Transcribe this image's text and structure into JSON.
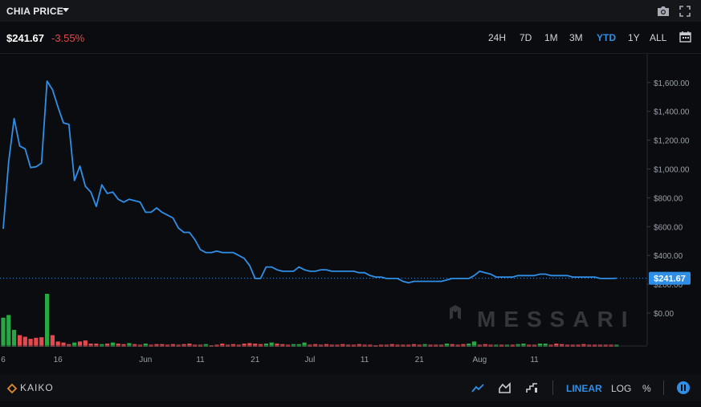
{
  "header": {
    "title": "CHIA PRICE",
    "price": "$241.67",
    "change": "-3.55%"
  },
  "ranges": [
    "24H",
    "7D",
    "1M",
    "3M",
    "YTD",
    "1Y",
    "ALL"
  ],
  "active_range": "YTD",
  "icons": {
    "camera": "camera-icon",
    "expand": "fullscreen-icon",
    "calendar": "calendar-icon"
  },
  "footer": {
    "brand": "KAIKO",
    "scales": [
      "LINEAR",
      "LOG",
      "%"
    ],
    "active_scale": "LINEAR",
    "tools": [
      "line-chart-icon",
      "area-chart-icon",
      "step-chart-icon"
    ]
  },
  "watermark": "MESSARI",
  "colors": {
    "line": "#2f8fe6",
    "up": "#27a844",
    "down": "#e5484d",
    "background": "#0b0c0f"
  },
  "chart_data": {
    "type": "line",
    "yticks": [
      "$1,600.00",
      "$1,400.00",
      "$1,200.00",
      "$1,000.00",
      "$800.00",
      "$600.00",
      "$400.00",
      "$200.00",
      "$0.00"
    ],
    "ylim": [
      0,
      1800
    ],
    "last_value_label": "$241.67",
    "xticks": [
      "6",
      "16",
      "Jun",
      "11",
      "21",
      "Jul",
      "11",
      "21",
      "Aug",
      "11"
    ],
    "xtick_day_index": [
      0,
      10,
      26,
      36,
      46,
      56,
      66,
      76,
      87,
      97
    ],
    "price": [
      585,
      1050,
      1350,
      1160,
      1140,
      1010,
      1015,
      1040,
      1610,
      1550,
      1430,
      1320,
      1310,
      920,
      1020,
      880,
      840,
      740,
      890,
      830,
      840,
      790,
      770,
      790,
      780,
      770,
      700,
      700,
      730,
      700,
      680,
      660,
      590,
      560,
      560,
      510,
      440,
      420,
      420,
      430,
      420,
      420,
      420,
      400,
      380,
      330,
      240,
      240,
      320,
      320,
      300,
      290,
      290,
      290,
      320,
      300,
      290,
      290,
      300,
      300,
      290,
      290,
      290,
      290,
      290,
      280,
      280,
      260,
      250,
      250,
      240,
      240,
      240,
      220,
      210,
      220,
      220,
      220,
      220,
      220,
      220,
      230,
      240,
      240,
      240,
      240,
      260,
      290,
      280,
      270,
      250,
      250,
      250,
      250,
      260,
      260,
      260,
      260,
      270,
      270,
      260,
      260,
      260,
      260,
      250,
      250,
      250,
      250,
      250,
      240,
      240,
      240,
      241.67
    ],
    "volume_relative": [
      0.55,
      0.6,
      0.32,
      0.22,
      0.19,
      0.15,
      0.17,
      0.18,
      1.0,
      0.22,
      0.1,
      0.08,
      0.05,
      0.08,
      0.1,
      0.12,
      0.06,
      0.06,
      0.05,
      0.06,
      0.08,
      0.06,
      0.05,
      0.07,
      0.05,
      0.04,
      0.06,
      0.04,
      0.05,
      0.05,
      0.04,
      0.05,
      0.04,
      0.05,
      0.06,
      0.04,
      0.04,
      0.05,
      0.03,
      0.04,
      0.06,
      0.04,
      0.05,
      0.04,
      0.06,
      0.07,
      0.06,
      0.05,
      0.06,
      0.08,
      0.06,
      0.05,
      0.04,
      0.05,
      0.05,
      0.08,
      0.04,
      0.05,
      0.04,
      0.05,
      0.04,
      0.04,
      0.05,
      0.04,
      0.04,
      0.05,
      0.04,
      0.04,
      0.03,
      0.04,
      0.04,
      0.05,
      0.04,
      0.04,
      0.04,
      0.05,
      0.04,
      0.05,
      0.04,
      0.04,
      0.04,
      0.06,
      0.05,
      0.04,
      0.05,
      0.06,
      0.1,
      0.04,
      0.05,
      0.04,
      0.04,
      0.04,
      0.04,
      0.04,
      0.05,
      0.06,
      0.04,
      0.04,
      0.06,
      0.06,
      0.04,
      0.06,
      0.05,
      0.04,
      0.04,
      0.04,
      0.05,
      0.04,
      0.04,
      0.04,
      0.04,
      0.04,
      0.04
    ],
    "volume_up": [
      true,
      true,
      true,
      false,
      false,
      false,
      false,
      false,
      true,
      false,
      false,
      false,
      false,
      true,
      false,
      false,
      false,
      false,
      true,
      false,
      true,
      false,
      false,
      true,
      false,
      false,
      true,
      false,
      false,
      false,
      false,
      false,
      false,
      false,
      false,
      false,
      false,
      true,
      false,
      false,
      false,
      false,
      false,
      false,
      false,
      false,
      false,
      false,
      true,
      true,
      false,
      false,
      false,
      true,
      true,
      true,
      false,
      false,
      false,
      false,
      false,
      false,
      false,
      false,
      false,
      false,
      false,
      false,
      false,
      false,
      false,
      false,
      false,
      false,
      false,
      false,
      false,
      true,
      false,
      false,
      false,
      true,
      false,
      false,
      false,
      true,
      true,
      false,
      false,
      false,
      true,
      false,
      true,
      false,
      true,
      true,
      false,
      false,
      true,
      true,
      false,
      false,
      false,
      false,
      false,
      false,
      false,
      false,
      false,
      false,
      false,
      false,
      true
    ]
  }
}
